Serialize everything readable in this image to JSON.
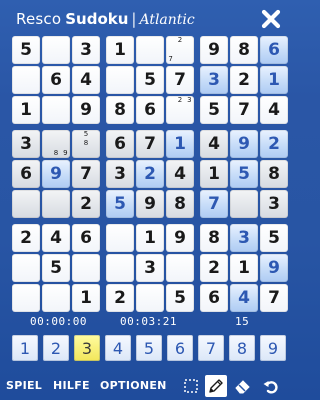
{
  "header": {
    "brand_part1": "Resco",
    "brand_part2": "Sudoku",
    "brand_separator": "|",
    "brand_part3": "Atlantic",
    "close_icon": "close-x-icon"
  },
  "board": {
    "rows": [
      [
        {
          "v": "5",
          "t": "given",
          "bg": "white"
        },
        {
          "v": "",
          "t": "",
          "bg": "white"
        },
        {
          "v": "3",
          "t": "given",
          "bg": "white"
        },
        {
          "v": "1",
          "t": "given",
          "bg": "white"
        },
        {
          "v": "",
          "t": "",
          "bg": "white"
        },
        {
          "v": "",
          "t": "",
          "bg": "white",
          "notes": [
            "",
            "2",
            "",
            "",
            "",
            "",
            "7",
            "",
            ""
          ]
        },
        {
          "v": "9",
          "t": "given",
          "bg": "white"
        },
        {
          "v": "8",
          "t": "given",
          "bg": "white"
        },
        {
          "v": "6",
          "t": "user",
          "bg": "blue"
        }
      ],
      [
        {
          "v": "",
          "t": "",
          "bg": "white"
        },
        {
          "v": "6",
          "t": "given",
          "bg": "white"
        },
        {
          "v": "4",
          "t": "given",
          "bg": "white"
        },
        {
          "v": "",
          "t": "",
          "bg": "white"
        },
        {
          "v": "5",
          "t": "given",
          "bg": "white"
        },
        {
          "v": "7",
          "t": "given",
          "bg": "white"
        },
        {
          "v": "3",
          "t": "user",
          "bg": "blue"
        },
        {
          "v": "2",
          "t": "given",
          "bg": "white"
        },
        {
          "v": "1",
          "t": "user",
          "bg": "blue"
        }
      ],
      [
        {
          "v": "1",
          "t": "given",
          "bg": "white"
        },
        {
          "v": "",
          "t": "",
          "bg": "white"
        },
        {
          "v": "9",
          "t": "given",
          "bg": "white"
        },
        {
          "v": "8",
          "t": "given",
          "bg": "white"
        },
        {
          "v": "6",
          "t": "given",
          "bg": "white"
        },
        {
          "v": "",
          "t": "",
          "bg": "white",
          "notes": [
            "",
            "2",
            "3",
            "",
            "",
            "",
            "",
            "",
            ""
          ]
        },
        {
          "v": "5",
          "t": "given",
          "bg": "white"
        },
        {
          "v": "7",
          "t": "given",
          "bg": "white"
        },
        {
          "v": "4",
          "t": "given",
          "bg": "white"
        }
      ],
      [
        {
          "v": "3",
          "t": "given",
          "bg": "gray"
        },
        {
          "v": "",
          "t": "",
          "bg": "gray",
          "notes": [
            "",
            "",
            "",
            "",
            "",
            "",
            "",
            "8",
            "9"
          ]
        },
        {
          "v": "",
          "t": "",
          "bg": "gray",
          "notes": [
            "",
            "5",
            "",
            "",
            "8",
            "",
            "",
            "",
            ""
          ]
        },
        {
          "v": "6",
          "t": "given",
          "bg": "gray"
        },
        {
          "v": "7",
          "t": "given",
          "bg": "gray"
        },
        {
          "v": "1",
          "t": "user",
          "bg": "blue"
        },
        {
          "v": "4",
          "t": "given",
          "bg": "gray"
        },
        {
          "v": "9",
          "t": "user",
          "bg": "blue"
        },
        {
          "v": "2",
          "t": "user",
          "bg": "blue"
        }
      ],
      [
        {
          "v": "6",
          "t": "given",
          "bg": "gray"
        },
        {
          "v": "9",
          "t": "user",
          "bg": "blue"
        },
        {
          "v": "7",
          "t": "given",
          "bg": "gray"
        },
        {
          "v": "3",
          "t": "given",
          "bg": "gray"
        },
        {
          "v": "2",
          "t": "user",
          "bg": "blue"
        },
        {
          "v": "4",
          "t": "given",
          "bg": "gray"
        },
        {
          "v": "1",
          "t": "given",
          "bg": "gray"
        },
        {
          "v": "5",
          "t": "user",
          "bg": "blue"
        },
        {
          "v": "8",
          "t": "given",
          "bg": "gray"
        }
      ],
      [
        {
          "v": "",
          "t": "",
          "bg": "gray"
        },
        {
          "v": "",
          "t": "",
          "bg": "gray"
        },
        {
          "v": "2",
          "t": "given",
          "bg": "gray"
        },
        {
          "v": "5",
          "t": "user",
          "bg": "blue"
        },
        {
          "v": "9",
          "t": "given",
          "bg": "gray"
        },
        {
          "v": "8",
          "t": "given",
          "bg": "gray"
        },
        {
          "v": "7",
          "t": "user",
          "bg": "blue"
        },
        {
          "v": "",
          "t": "",
          "bg": "gray"
        },
        {
          "v": "3",
          "t": "given",
          "bg": "gray"
        }
      ],
      [
        {
          "v": "2",
          "t": "given",
          "bg": "white"
        },
        {
          "v": "4",
          "t": "given",
          "bg": "white"
        },
        {
          "v": "6",
          "t": "given",
          "bg": "white"
        },
        {
          "v": "",
          "t": "",
          "bg": "white"
        },
        {
          "v": "1",
          "t": "given",
          "bg": "white"
        },
        {
          "v": "9",
          "t": "given",
          "bg": "white"
        },
        {
          "v": "8",
          "t": "given",
          "bg": "white"
        },
        {
          "v": "3",
          "t": "user",
          "bg": "blue"
        },
        {
          "v": "5",
          "t": "given",
          "bg": "white"
        }
      ],
      [
        {
          "v": "",
          "t": "",
          "bg": "white"
        },
        {
          "v": "5",
          "t": "given",
          "bg": "white"
        },
        {
          "v": "",
          "t": "",
          "bg": "white"
        },
        {
          "v": "",
          "t": "",
          "bg": "white"
        },
        {
          "v": "3",
          "t": "given",
          "bg": "white"
        },
        {
          "v": "",
          "t": "",
          "bg": "white"
        },
        {
          "v": "2",
          "t": "given",
          "bg": "white"
        },
        {
          "v": "1",
          "t": "given",
          "bg": "white"
        },
        {
          "v": "9",
          "t": "user",
          "bg": "blue"
        }
      ],
      [
        {
          "v": "",
          "t": "",
          "bg": "white"
        },
        {
          "v": "",
          "t": "",
          "bg": "white"
        },
        {
          "v": "1",
          "t": "given",
          "bg": "white"
        },
        {
          "v": "2",
          "t": "given",
          "bg": "white"
        },
        {
          "v": "",
          "t": "",
          "bg": "white"
        },
        {
          "v": "5",
          "t": "given",
          "bg": "white"
        },
        {
          "v": "6",
          "t": "given",
          "bg": "white"
        },
        {
          "v": "4",
          "t": "user",
          "bg": "blue"
        },
        {
          "v": "7",
          "t": "given",
          "bg": "white"
        }
      ]
    ]
  },
  "status": {
    "timer_left": "00:00:00",
    "timer_center": "00:03:21",
    "count": "15"
  },
  "palette": {
    "numbers": [
      "1",
      "2",
      "3",
      "4",
      "5",
      "6",
      "7",
      "8",
      "9"
    ],
    "selected": "3"
  },
  "menu": {
    "items": [
      "SPIEL",
      "HILFE",
      "OPTIONEN"
    ],
    "tools": [
      "selection-square-icon",
      "pencil-icon",
      "eraser-icon",
      "undo-icon"
    ],
    "active_tool": "pencil-icon"
  },
  "colors": {
    "background": "#2a56a6",
    "user_digit": "#2d58b2",
    "given_digit": "#1a1a1a",
    "selected_palette": "#f2e65a"
  }
}
